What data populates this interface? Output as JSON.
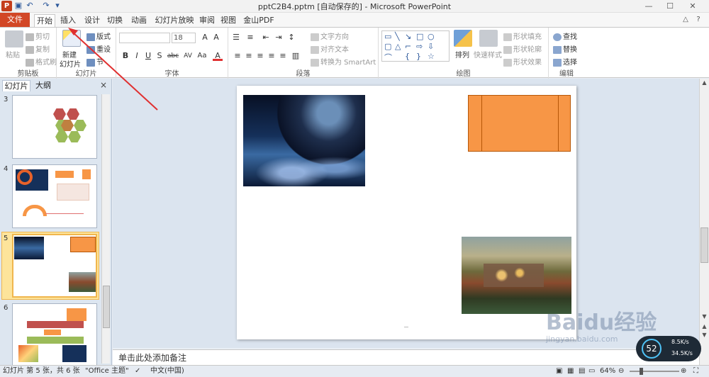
{
  "window": {
    "title": "pptC2B4.pptm [自动保存的] - Microsoft PowerPoint",
    "app_icon_letter": "P"
  },
  "tabs": [
    "文件",
    "开始",
    "插入",
    "设计",
    "切换",
    "动画",
    "幻灯片放映",
    "审阅",
    "视图",
    "金山PDF"
  ],
  "ribbon": {
    "clipboard": {
      "paste": "粘贴",
      "cut": "剪切",
      "copy": "复制",
      "format_painter": "格式刷",
      "label": "剪贴板"
    },
    "slides": {
      "new_slide": "新建",
      "new_slide_2": "幻灯片",
      "layout": "版式",
      "reset": "重设",
      "section": "节",
      "label": "幻灯片"
    },
    "font": {
      "font_name": "",
      "font_size": "18",
      "bold": "B",
      "italic": "I",
      "underline": "U",
      "shadow": "S",
      "strike": "abc",
      "spacing": "AV",
      "case": "Aa",
      "color": "A",
      "label": "字体"
    },
    "paragraph": {
      "text_direction": "文字方向",
      "align_text": "对齐文本",
      "convert_smartart": "转换为 SmartArt",
      "label": "段落"
    },
    "drawing": {
      "arrange": "排列",
      "quick_styles": "快速样式",
      "shape_fill": "形状填充",
      "shape_outline": "形状轮廓",
      "shape_effects": "形状效果",
      "label": "绘图"
    },
    "editing": {
      "find": "查找",
      "replace": "替换",
      "select": "选择",
      "label": "编辑"
    }
  },
  "left_pane": {
    "tabs": [
      "幻灯片",
      "大纲"
    ],
    "close_glyph": "×",
    "thumbnails": [
      {
        "number": "3"
      },
      {
        "number": "4"
      },
      {
        "number": "5",
        "selected": true
      },
      {
        "number": "6"
      }
    ]
  },
  "notes_placeholder": "单击此处添加备注",
  "status": {
    "slide_info": "幻灯片 第 5 张，共 6 张",
    "theme": "\"Office 主题\"",
    "language": "中文(中国)",
    "zoom": "64%"
  },
  "watermark": {
    "brand": "Baidu经验",
    "url": "jingyan.baidu.com"
  },
  "net_meter": {
    "value": "52",
    "down": "8.5K/s",
    "up": "34.5K/s"
  },
  "colors": {
    "accent_file_tab": "#d24726",
    "shape_orange": "#f79646",
    "annotation_arrow": "#e03030"
  }
}
